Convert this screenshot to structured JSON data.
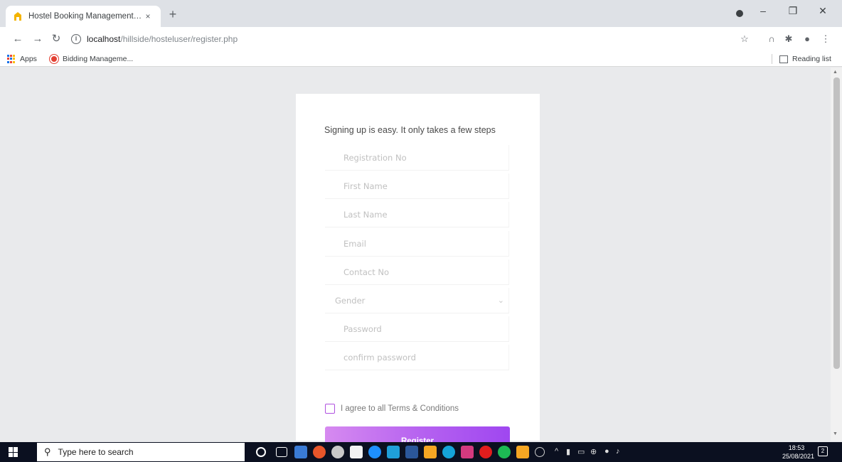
{
  "browser": {
    "tab_title": "Hostel Booking Management Sy",
    "tab_close": "×",
    "new_tab": "+",
    "url_host": "localhost",
    "url_path": "/hillside/hosteluser/register.php",
    "window_controls": {
      "minimize": "–",
      "restore": "❐",
      "close": "✕"
    },
    "bookmarks": {
      "apps": "Apps",
      "item1": "Bidding Manageme...",
      "reading_list": "Reading list"
    }
  },
  "form": {
    "intro": "Signing up is easy. It only takes a few steps",
    "fields": [
      {
        "placeholder": "Registration No"
      },
      {
        "placeholder": "First Name"
      },
      {
        "placeholder": "Last Name"
      },
      {
        "placeholder": "Email"
      },
      {
        "placeholder": "Contact No"
      },
      {
        "placeholder": "Gender",
        "type": "select"
      },
      {
        "placeholder": "Password"
      },
      {
        "placeholder": "confirm password"
      }
    ],
    "agree_label": "I agree to all Terms & Conditions",
    "agree_checked": false,
    "register_label": "Register",
    "button_gradient": [
      "#d68af0",
      "#9f47f0"
    ]
  },
  "taskbar": {
    "search_placeholder": "Type here to search",
    "time": "18:53",
    "date": "25/08/2021",
    "notification_count": "2"
  }
}
